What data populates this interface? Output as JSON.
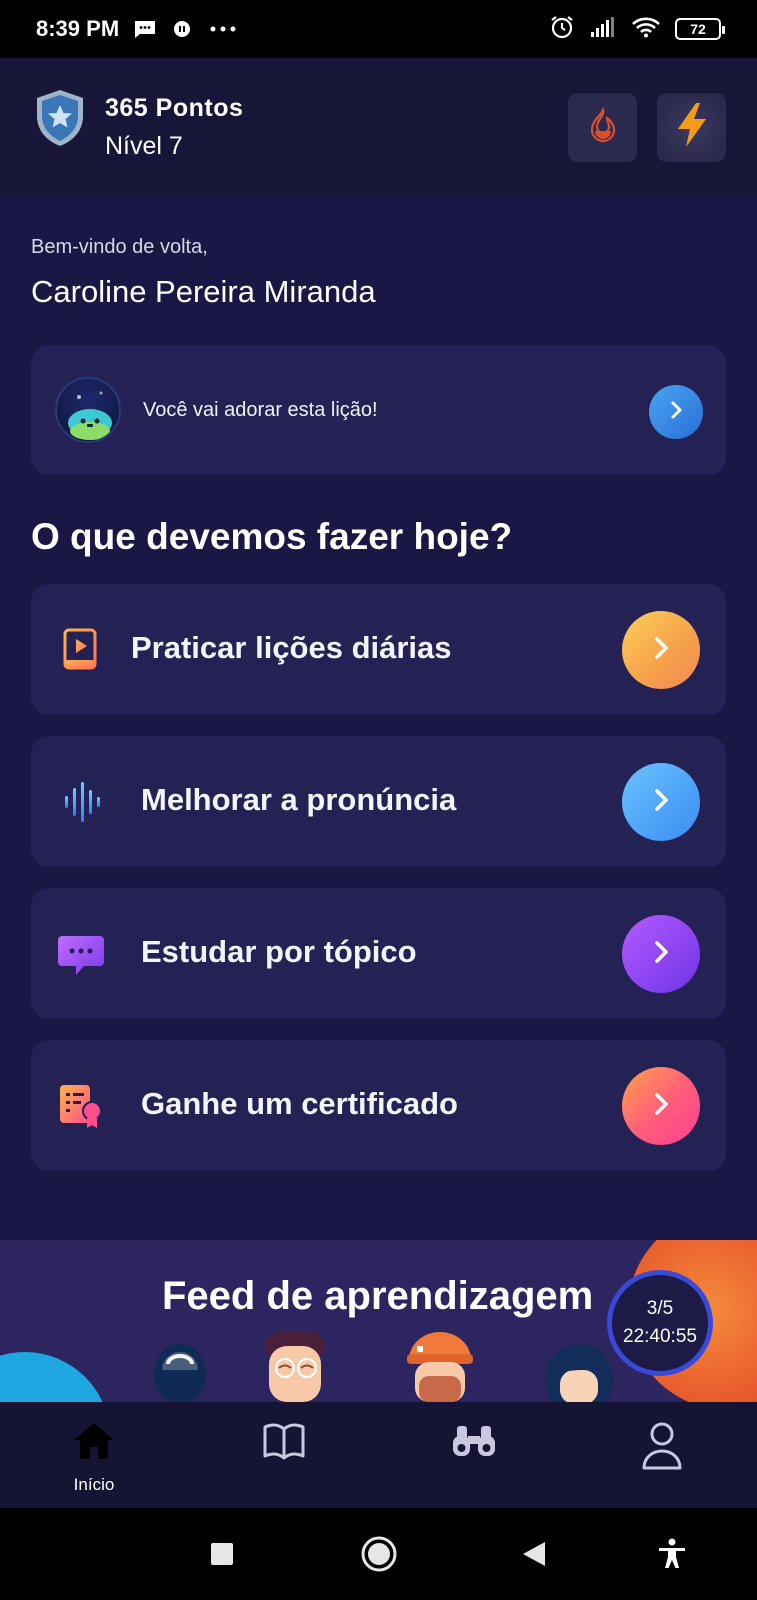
{
  "status_bar": {
    "time": "8:39 PM",
    "battery": "72",
    "icons": [
      "message-icon",
      "record-icon",
      "more-dots-icon",
      "alarm-icon",
      "signal-icon",
      "wifi-icon",
      "battery-icon"
    ]
  },
  "header": {
    "points": "365 Pontos",
    "level": "Nível 7",
    "badge_icon": "shield-star-icon",
    "button_icons": [
      "flame-outline-icon",
      "lightning-icon"
    ]
  },
  "welcome": {
    "greeting": "Bem-vindo de volta,",
    "name": "Caroline Pereira Miranda"
  },
  "suggestion": {
    "text": "Você vai adorar esta lição!",
    "avatar_icon": "mascot-avatar-icon"
  },
  "section_title": "O que devemos fazer hoje?",
  "actions": [
    {
      "label": "Praticar lições diárias",
      "icon": "lesson-book-icon",
      "color": "#f7a44a"
    },
    {
      "label": "Melhorar a pronúncia",
      "icon": "sound-wave-icon",
      "color": "#3b8cf2"
    },
    {
      "label": "Estudar por tópico",
      "icon": "chat-bubble-icon",
      "color": "#8a3df0"
    },
    {
      "label": "Ganhe um certificado",
      "icon": "certificate-icon",
      "color": "#ff5b7a"
    }
  ],
  "feed": {
    "title": "Feed de aprendizagem",
    "timer_count": "3/5",
    "timer_time": "22:40:55"
  },
  "bottom_nav": {
    "items": [
      {
        "label": "Início",
        "icon": "home-icon",
        "active": true
      },
      {
        "label": "",
        "icon": "book-icon",
        "active": false
      },
      {
        "label": "",
        "icon": "binoculars-icon",
        "active": false
      },
      {
        "label": "",
        "icon": "profile-icon",
        "active": false
      }
    ]
  },
  "system_nav": {
    "icons": [
      "recents-square-icon",
      "home-circle-icon",
      "back-triangle-icon",
      "accessibility-icon"
    ]
  },
  "colors": {
    "background": "#1a1745",
    "card": "#242255",
    "header": "#171638",
    "accent_blue": "#3b8cf2"
  }
}
